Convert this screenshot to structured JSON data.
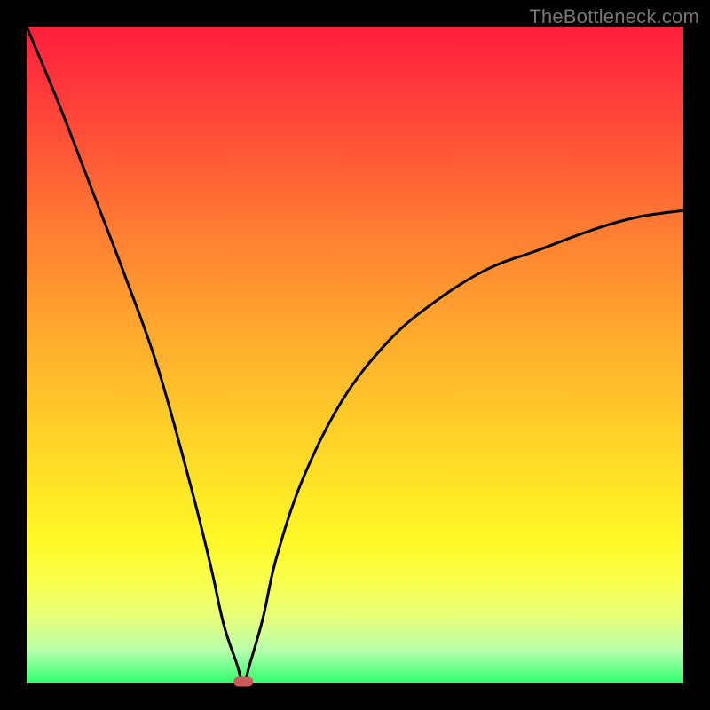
{
  "watermark": {
    "text": "TheBottleneck.com"
  },
  "chart_data": {
    "type": "line",
    "title": "",
    "xlabel": "",
    "ylabel": "",
    "xlim": [
      0,
      1
    ],
    "ylim": [
      0,
      100
    ],
    "grid": false,
    "legend": false,
    "background_gradient": {
      "direction": "vertical",
      "stops": [
        {
          "pos": 0.0,
          "color": "#ff1e3c",
          "meaning": "100"
        },
        {
          "pos": 0.5,
          "color": "#ffc729",
          "meaning": "50"
        },
        {
          "pos": 1.0,
          "color": "#2dff6c",
          "meaning": "0"
        }
      ]
    },
    "series": [
      {
        "name": "bottleneck-curve",
        "x": [
          0.0,
          0.05,
          0.1,
          0.15,
          0.2,
          0.25,
          0.28,
          0.3,
          0.32,
          0.33,
          0.34,
          0.36,
          0.38,
          0.42,
          0.48,
          0.55,
          0.62,
          0.7,
          0.78,
          0.86,
          0.93,
          1.0
        ],
        "values": [
          100,
          88,
          75,
          62,
          48,
          30,
          18,
          9,
          3,
          0,
          3,
          10,
          19,
          31,
          43,
          52,
          58,
          63,
          66,
          69,
          71,
          72
        ]
      }
    ],
    "marker": {
      "x": 0.33,
      "y": 0,
      "color": "#cc5a5a",
      "shape": "rounded-rect"
    }
  }
}
